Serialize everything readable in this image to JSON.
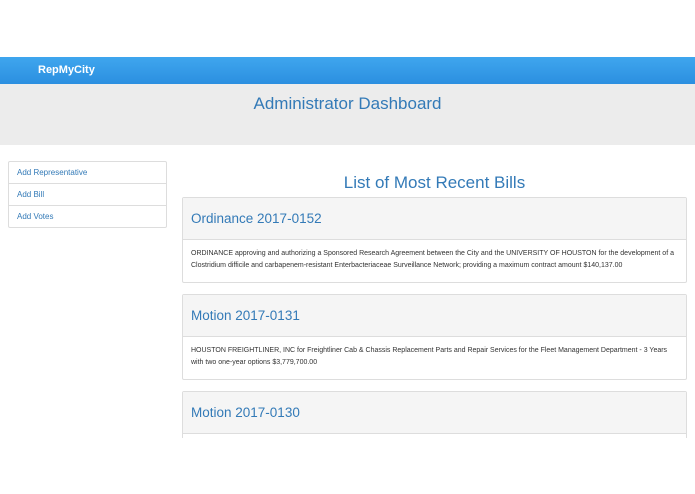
{
  "navbar": {
    "brand": "RepMyCity"
  },
  "header": {
    "title": "Administrator Dashboard"
  },
  "sidebar": {
    "items": [
      {
        "label": "Add Representative"
      },
      {
        "label": "Add Bill"
      },
      {
        "label": "Add Votes"
      }
    ]
  },
  "main": {
    "title": "List of Most Recent Bills",
    "bills": [
      {
        "title": "Ordinance 2017-0152",
        "description": "ORDINANCE approving and authorizing a Sponsored Research Agreement between the City and the UNIVERSITY OF HOUSTON for the development of a Clostridium difficile and carbapenem-resistant Enterbacteriaceae Surveillance Network; providing a maximum contract amount $140,137.00"
      },
      {
        "title": "Motion 2017-0131",
        "description": "HOUSTON FREIGHTLINER, INC for Freightliner Cab & Chassis Replacement Parts and Repair Services for the Fleet Management Department - 3 Years with two one-year options $3,779,700.00"
      },
      {
        "title": "Motion 2017-0130",
        "description": ""
      }
    ]
  },
  "colors": {
    "navbar": "#2b8fe0",
    "link": "#337ab7",
    "jumbotron": "#ececec",
    "panel_heading": "#f5f5f5",
    "border": "#dddddd"
  }
}
